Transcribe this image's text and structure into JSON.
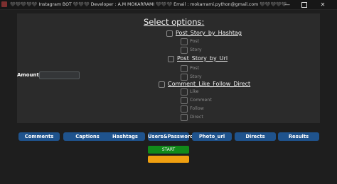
{
  "window": {
    "title": "🖤🖤🖤🖤🖤 Instagram BOT 🖤🖤🖤 Developer : A.M MOKARRAMI 🖤🖤🖤 Email : mokarrami.python@gmail.com 🖤🖤🖤🖤🖤",
    "minimize_label": "—",
    "close_label": "✕"
  },
  "form": {
    "heading": "Select options:",
    "amount_label": "Amount-->",
    "amount_value": ""
  },
  "options": [
    {
      "label": "Post_Story_by_Hashtag",
      "checked": false,
      "subs": [
        {
          "label": "Post",
          "checked": false
        },
        {
          "label": "Story",
          "checked": false
        }
      ]
    },
    {
      "label": "Post_Story_by_Url",
      "checked": false,
      "subs": [
        {
          "label": "Post",
          "checked": false
        },
        {
          "label": "Story",
          "checked": false
        }
      ]
    },
    {
      "label": "Comment_Like_Follow_Direct",
      "checked": false,
      "subs": [
        {
          "label": "Like",
          "checked": false
        },
        {
          "label": "Comment",
          "checked": false
        },
        {
          "label": "Follow",
          "checked": false
        },
        {
          "label": "Direct",
          "checked": false
        }
      ]
    }
  ],
  "toolbar": {
    "buttons": [
      "Comments",
      "Captions",
      "Hashtags",
      "Users&Passwords",
      "Photo_url",
      "Directs",
      "Results"
    ],
    "start_label": "START",
    "stop_label": "STOP"
  },
  "colors": {
    "background": "#1e1e1e",
    "panel": "#2b2b2b",
    "tab_button": "#1f538d",
    "start": "#118a1a",
    "stop": "#f0a010"
  }
}
